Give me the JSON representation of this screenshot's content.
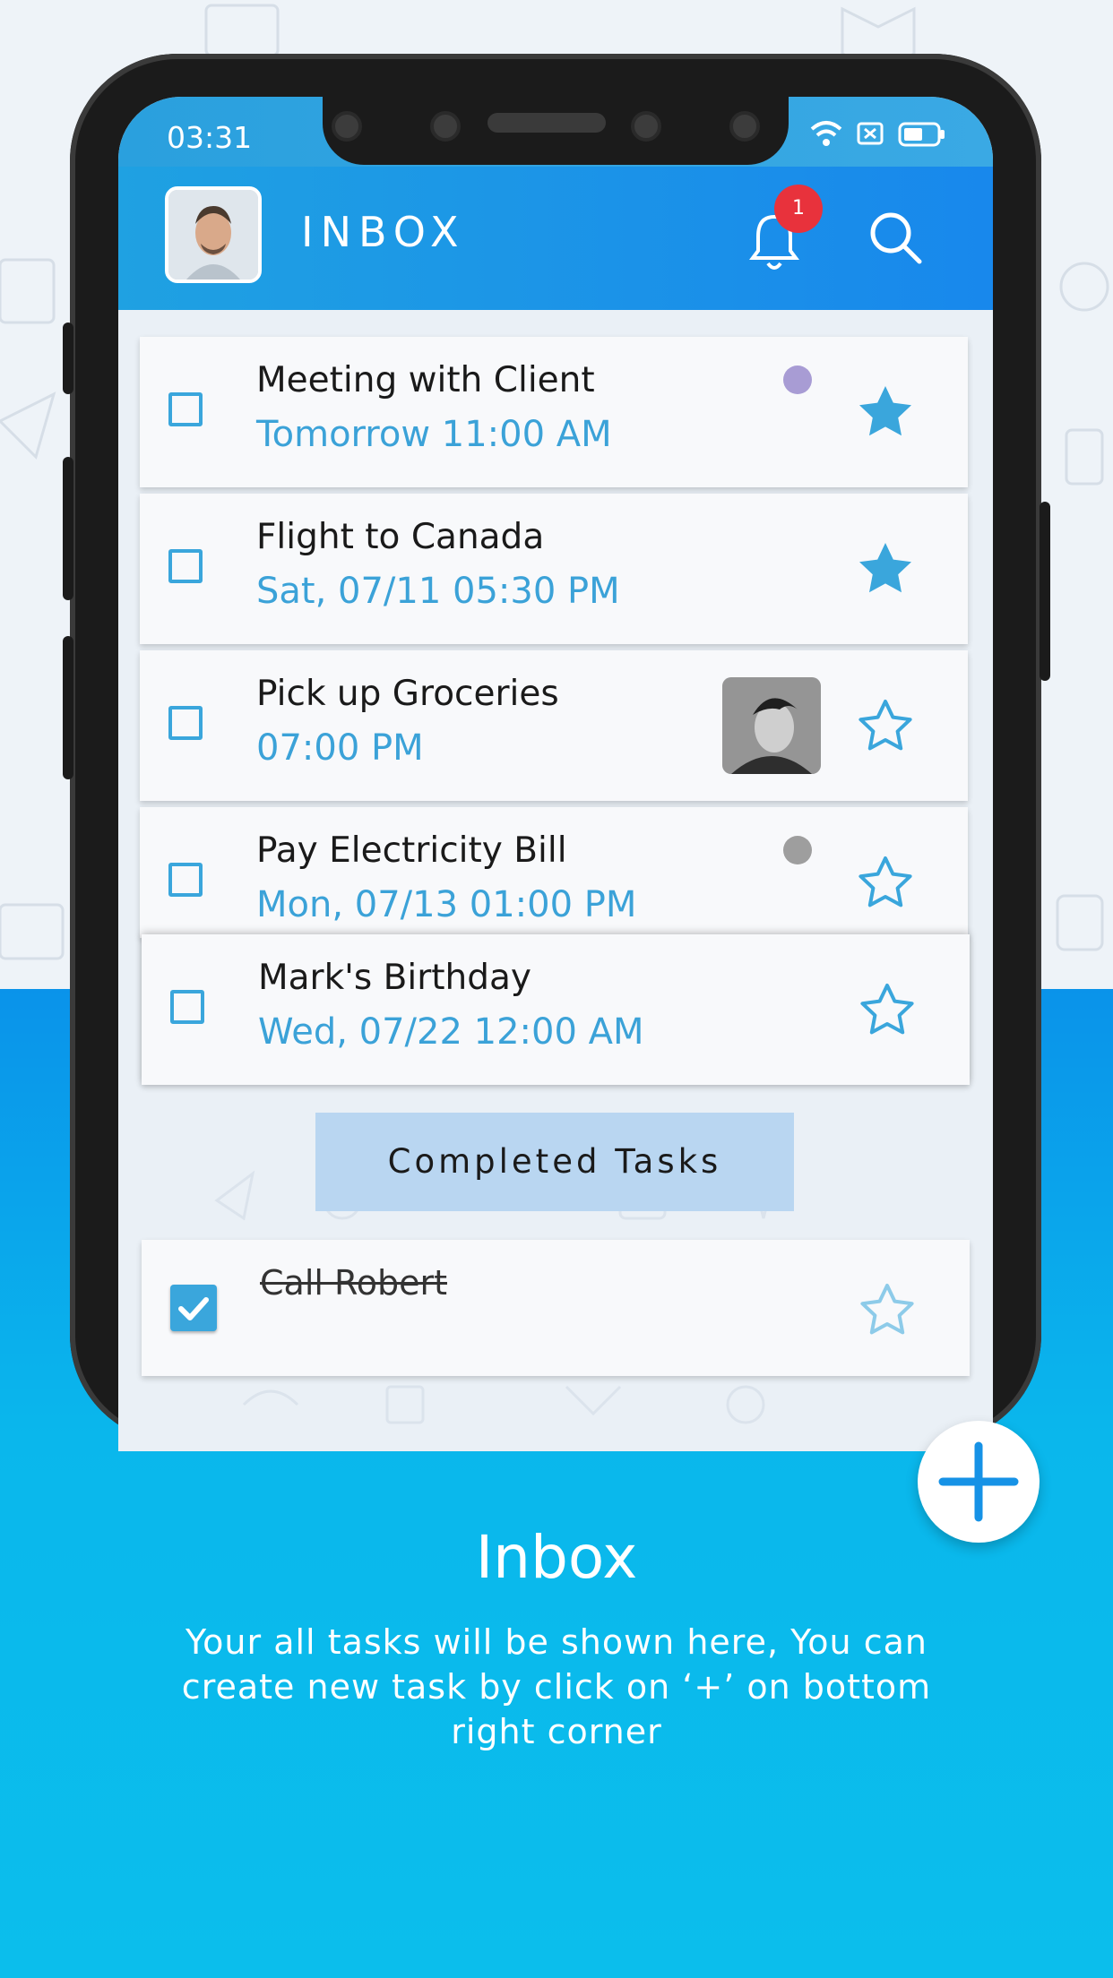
{
  "status_bar": {
    "time": "03:31"
  },
  "app_bar": {
    "title": "INBOX",
    "notification_count": "1"
  },
  "tasks": [
    {
      "title": "Meeting with Client",
      "time": "Tomorrow 11:00 AM",
      "starred": true,
      "dot_color": "#a89cd4"
    },
    {
      "title": "Flight to Canada",
      "time": "Sat, 07/11 05:30 PM",
      "starred": true
    },
    {
      "title": "Pick up Groceries",
      "time": "07:00 PM",
      "starred": false
    },
    {
      "title": "Pay Electricity Bill",
      "time": "Mon, 07/13 01:00 PM",
      "starred": false,
      "dot_color": "#9e9e9e"
    },
    {
      "title": "Mark's Birthday",
      "time": "Wed, 07/22 12:00 AM",
      "starred": false
    }
  ],
  "completed": {
    "button_label": "Completed Tasks",
    "tasks": [
      {
        "title": "Call Robert",
        "checked": true,
        "starred": false
      }
    ]
  },
  "caption": {
    "title": "Inbox",
    "body": "Your all tasks will be shown here, You can create new task by click on ‘+’  on bottom right corner"
  },
  "colors": {
    "accent": "#1888ec",
    "task_time": "#3ba2d8",
    "badge": "#e8323c",
    "star": "#3aa6dc"
  }
}
